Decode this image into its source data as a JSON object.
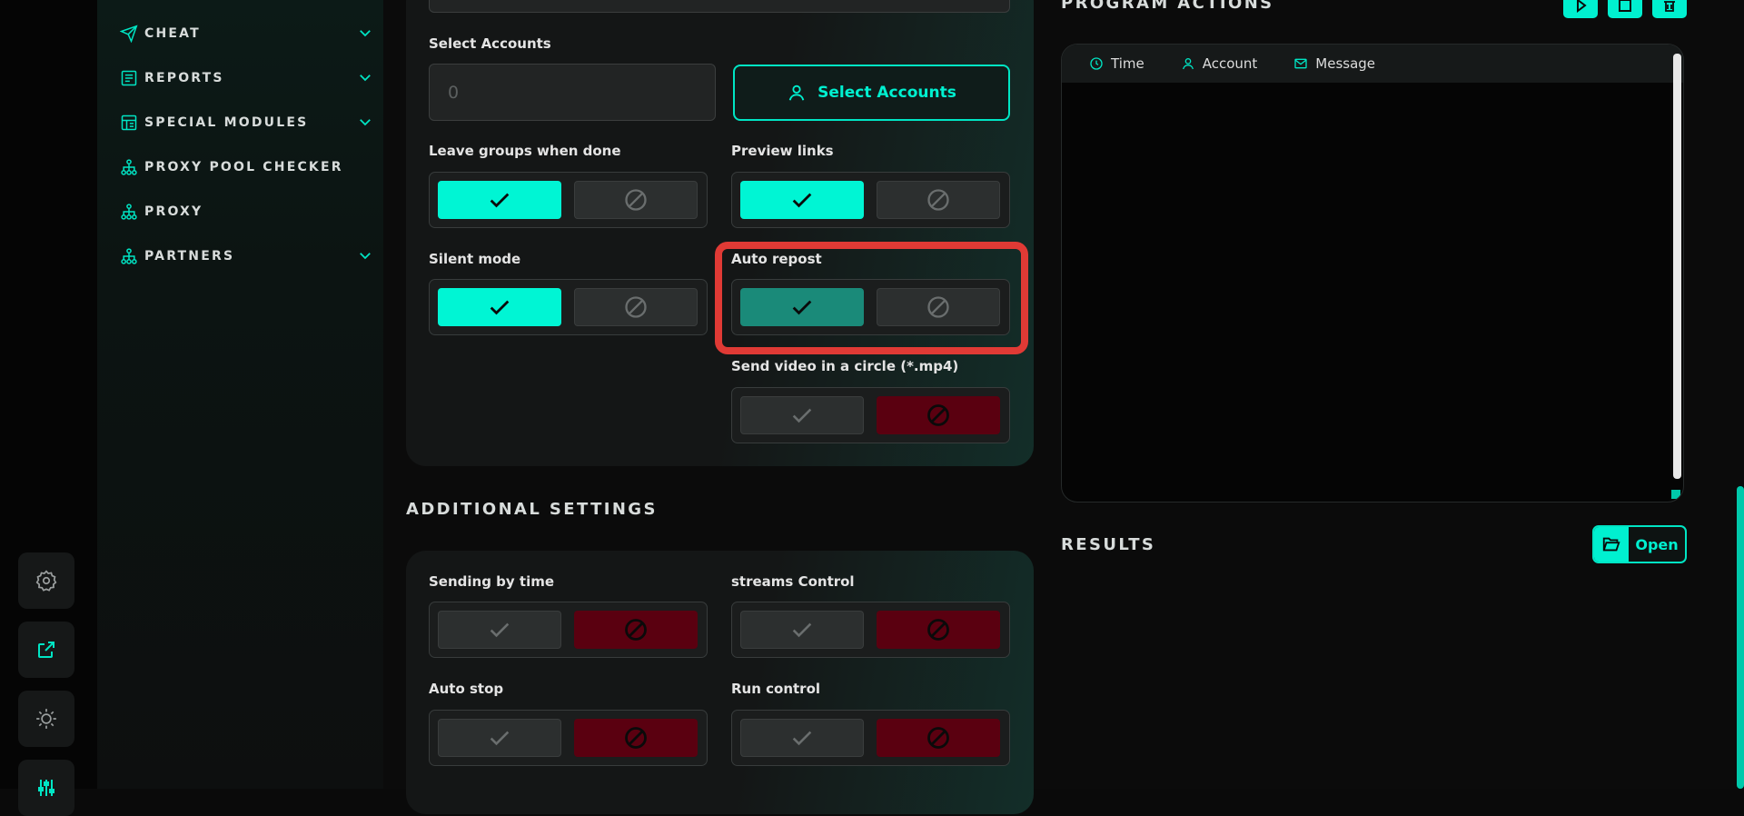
{
  "rail": {
    "buttons": [
      {
        "name": "settings-gear-icon"
      },
      {
        "name": "external-link-icon"
      },
      {
        "name": "theme-toggle-icon"
      },
      {
        "name": "sliders-icon"
      }
    ]
  },
  "sidebar": {
    "items": [
      {
        "label": "CHEAT",
        "icon": "send-plane-icon",
        "has_chevron": true
      },
      {
        "label": "REPORTS",
        "icon": "report-icon",
        "has_chevron": true
      },
      {
        "label": "SPECIAL MODULES",
        "icon": "modules-icon",
        "has_chevron": true
      },
      {
        "label": "PROXY POOL CHECKER",
        "icon": "network-icon",
        "has_chevron": false
      },
      {
        "label": "PROXY",
        "icon": "network-icon",
        "has_chevron": false
      },
      {
        "label": "PARTNERS",
        "icon": "network-icon",
        "has_chevron": true
      }
    ]
  },
  "settings": {
    "select_accounts_label": "Select Accounts",
    "select_accounts_value": "0",
    "select_accounts_button": "Select Accounts",
    "leave_groups_label": "Leave groups when done",
    "preview_links_label": "Preview links",
    "silent_mode_label": "Silent mode",
    "auto_repost_label": "Auto repost",
    "send_video_label": "Send video in a circle (*.mp4)"
  },
  "additional": {
    "title": "ADDITIONAL SETTINGS",
    "sending_by_time_label": "Sending by time",
    "streams_control_label": "streams Control",
    "auto_stop_label": "Auto stop",
    "run_control_label": "Run control"
  },
  "program_actions": {
    "title": "PROGRAM ACTIONS",
    "columns": [
      "Time",
      "Account",
      "Message"
    ]
  },
  "results": {
    "title": "RESULTS",
    "open_button": "Open"
  },
  "colors": {
    "accent": "#00f5d4",
    "accent_dim": "#1a8a79",
    "off_red": "#5a0010",
    "highlight": "#e03a35"
  }
}
